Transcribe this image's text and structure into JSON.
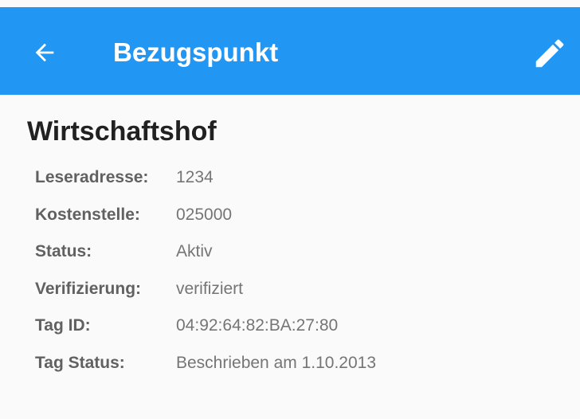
{
  "colors": {
    "app_bar": "#2196f3",
    "app_bar_text": "#ffffff",
    "background": "#fafafa",
    "title_text": "#212121",
    "label_text": "#616161",
    "value_text": "#757575"
  },
  "app_bar": {
    "title": "Bezugspunkt",
    "back_icon": "arrow-left-icon",
    "edit_icon": "pencil-icon"
  },
  "record": {
    "name": "Wirtschaftshof",
    "details": [
      {
        "label": "Leseradresse:",
        "value": "1234"
      },
      {
        "label": "Kostenstelle:",
        "value": "025000"
      },
      {
        "label": "Status:",
        "value": "Aktiv"
      },
      {
        "label": "Verifizierung:",
        "value": "verifiziert"
      },
      {
        "label": "Tag ID:",
        "value": "04:92:64:82:BA:27:80"
      },
      {
        "label": "Tag Status:",
        "value": "Beschrieben am 1.10.2013"
      }
    ]
  }
}
